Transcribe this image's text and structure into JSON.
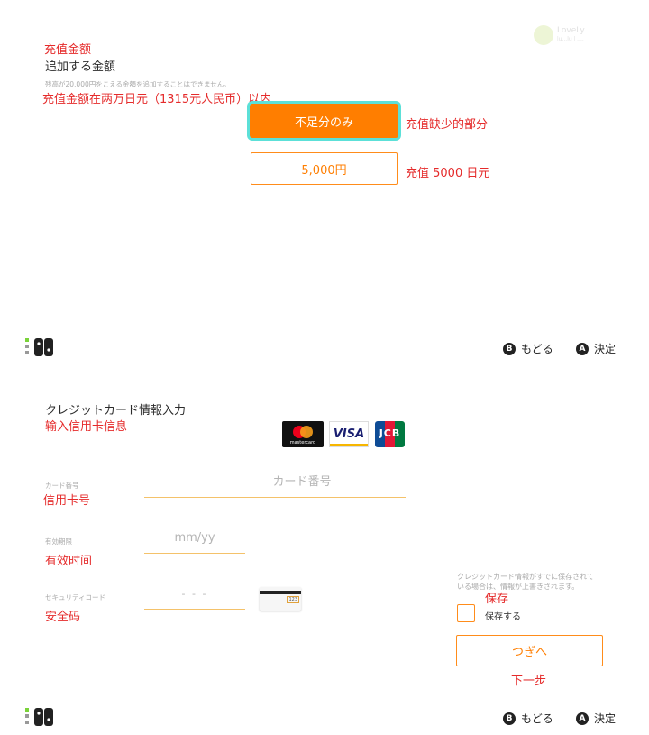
{
  "top": {
    "note_amount": "充值金额",
    "title": "追加する金額",
    "subtitle": "残高が20,000円をこえる金額を追加することはできません。",
    "note_limit": "充值金额在两万日元（1315元人民币）以内",
    "primary_button": "不足分のみ",
    "note_primary": "充值缺少的部分",
    "secondary_button": "5,000円",
    "note_secondary": "充值 5000 日元",
    "watermark_line1": "LoveLy",
    "watermark_line2": "lu...lu l ....",
    "footer": {
      "b_key": "B",
      "back": "もどる",
      "a_key": "A",
      "ok": "決定"
    }
  },
  "bottom": {
    "title": "クレジットカード情報入力",
    "note_title": "输入信用卡信息",
    "brands": {
      "mastercard": "mastercard",
      "visa": "VISA",
      "jcb": "JCB"
    },
    "card_number": {
      "label": "カード番号",
      "placeholder": "カード番号",
      "note": "信用卡号"
    },
    "expiry": {
      "label": "有効期限",
      "placeholder": "mm/yy",
      "note": "有效时间"
    },
    "security": {
      "label": "セキュリティコード",
      "placeholder": "- - -",
      "note": "安全码",
      "card_code": "123"
    },
    "info_line1": "クレジットカード情報がすでに保存されて",
    "info_line2": "いる場合は、情報が上書きされます。",
    "note_save": "保存",
    "save_label": "保存する",
    "next_button": "つぎへ",
    "note_next": "下一步",
    "footer": {
      "b_key": "B",
      "back": "もどる",
      "a_key": "A",
      "ok": "決定"
    }
  }
}
